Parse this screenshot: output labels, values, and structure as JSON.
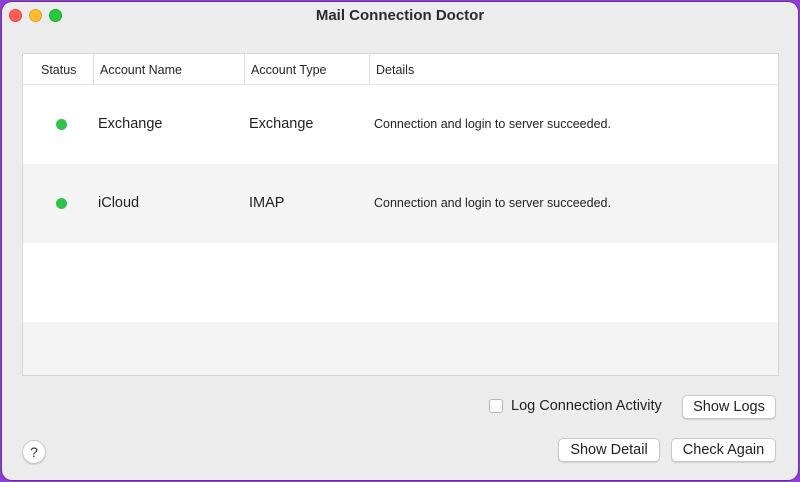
{
  "window": {
    "title": "Mail Connection Doctor",
    "controls": [
      "close",
      "minimize",
      "maximize"
    ]
  },
  "table": {
    "columns": {
      "status": "Status",
      "account_name": "Account Name",
      "account_type": "Account Type",
      "details": "Details"
    },
    "rows": [
      {
        "status": "connected",
        "status_color": "#30c24a",
        "account_name": "Exchange",
        "account_type": "Exchange",
        "details": "Connection and login to server succeeded."
      },
      {
        "status": "connected",
        "status_color": "#30c24a",
        "account_name": "iCloud",
        "account_type": "IMAP",
        "details": "Connection and login to server succeeded."
      }
    ]
  },
  "log_connection_activity": {
    "label": "Log Connection Activity",
    "checked": false
  },
  "buttons": {
    "show_logs": "Show Logs",
    "show_detail": "Show Detail",
    "check_again": "Check Again",
    "help": "?"
  }
}
